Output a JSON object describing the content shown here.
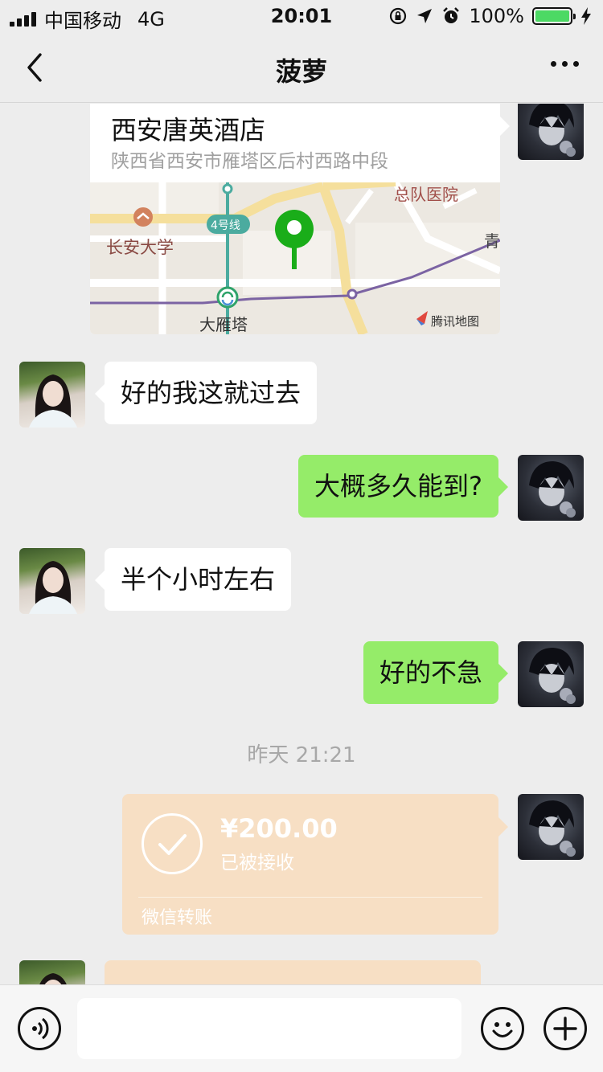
{
  "status_bar": {
    "carrier": "中国移动",
    "network": "4G",
    "time": "20:01",
    "battery": "100%",
    "battery_level": 1.0,
    "icons": [
      "signal-icon",
      "orientation-lock-icon",
      "location-arrow-icon",
      "alarm-icon",
      "battery-icon",
      "charging-icon"
    ]
  },
  "nav": {
    "title": "菠萝",
    "back_icon": "chevron-left-icon",
    "more_icon": "more-dots-icon"
  },
  "location_card": {
    "name": "西安唐英酒店",
    "address": "陕西省西安市雁塔区后村西路中段",
    "map_labels": {
      "hospital": "总队医院",
      "university": "长安大学",
      "metro_line": "4号线",
      "station": "大雁塔",
      "edge_label": "青",
      "brand": "腾讯地图"
    }
  },
  "messages": [
    {
      "side": "left",
      "text": "好的我这就过去"
    },
    {
      "side": "right",
      "text": "大概多久能到?"
    },
    {
      "side": "left",
      "text": "半个小时左右"
    },
    {
      "side": "right",
      "text": "好的不急"
    }
  ],
  "timestamp": "昨天 21:21",
  "transfer": {
    "amount": "¥200.00",
    "status": "已被接收",
    "footer": "微信转账"
  },
  "input_bar": {
    "placeholder": "",
    "voice_icon": "voice-icon",
    "emoji_icon": "emoji-icon",
    "plus_icon": "plus-icon"
  },
  "colors": {
    "background": "#ededed",
    "bubble_green": "#95ec69",
    "bubble_white": "#ffffff",
    "transfer_card": "#f7dfc4",
    "map_pin": "#1aad19"
  }
}
